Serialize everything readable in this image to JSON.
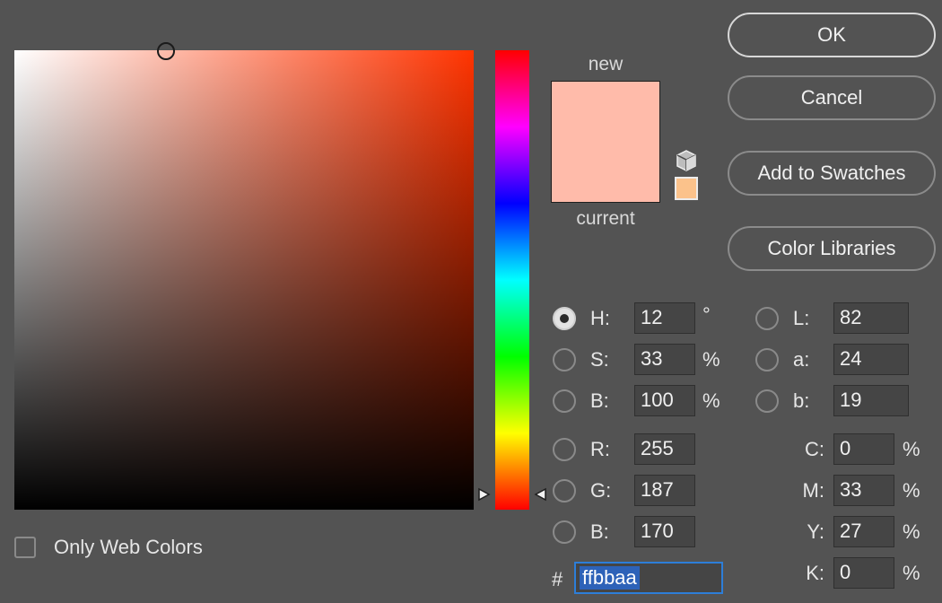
{
  "colors": {
    "hue_base": "#ff3300",
    "new": "#ffbbaa",
    "current": "#ffbbaa",
    "gamut_warning": "#fbc28b"
  },
  "picker": {
    "saturation_cursor": 0.33,
    "brightness_cursor": 1.0,
    "hue_position": 0.967
  },
  "preview": {
    "new_label": "new",
    "current_label": "current"
  },
  "icons": {
    "gamut": "cube-icon",
    "hue_left": "triangle-right-icon",
    "hue_right": "triangle-left-icon"
  },
  "buttons": {
    "ok": "OK",
    "cancel": "Cancel",
    "add_to_swatches": "Add to Swatches",
    "color_libraries": "Color Libraries"
  },
  "hsb": {
    "h": {
      "label": "H:",
      "value": "12",
      "unit": "°",
      "selected": true
    },
    "s": {
      "label": "S:",
      "value": "33",
      "unit": "%"
    },
    "b": {
      "label": "B:",
      "value": "100",
      "unit": "%"
    }
  },
  "rgb": {
    "r": {
      "label": "R:",
      "value": "255"
    },
    "g": {
      "label": "G:",
      "value": "187"
    },
    "b": {
      "label": "B:",
      "value": "170"
    }
  },
  "lab": {
    "l": {
      "label": "L:",
      "value": "82"
    },
    "a": {
      "label": "a:",
      "value": "24"
    },
    "b": {
      "label": "b:",
      "value": "19"
    }
  },
  "cmyk": {
    "c": {
      "label": "C:",
      "value": "0",
      "unit": "%"
    },
    "m": {
      "label": "M:",
      "value": "33",
      "unit": "%"
    },
    "y": {
      "label": "Y:",
      "value": "27",
      "unit": "%"
    },
    "k": {
      "label": "K:",
      "value": "0",
      "unit": "%"
    }
  },
  "hex": {
    "label": "#",
    "value": "ffbbaa"
  },
  "web_colors": {
    "label": "Only Web Colors",
    "checked": false
  }
}
